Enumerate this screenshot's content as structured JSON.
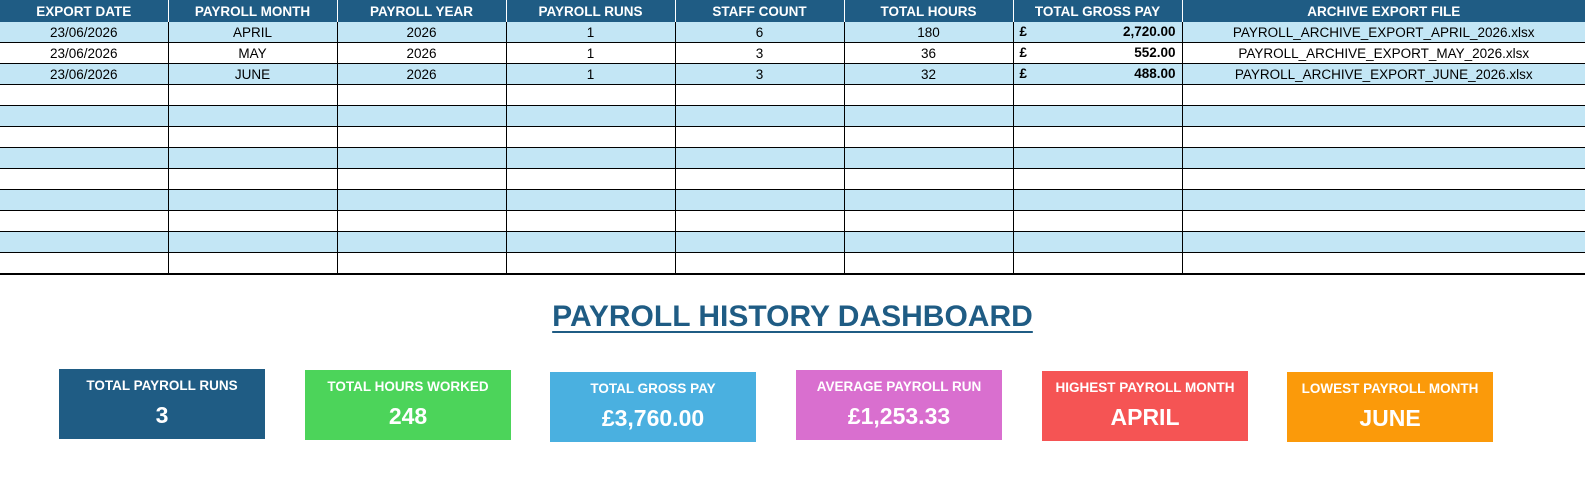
{
  "table": {
    "headers": [
      "EXPORT DATE",
      "PAYROLL MONTH",
      "PAYROLL YEAR",
      "PAYROLL RUNS",
      "STAFF COUNT",
      "TOTAL HOURS",
      "TOTAL GROSS PAY",
      "ARCHIVE EXPORT FILE"
    ],
    "currency_symbol": "£",
    "rows": [
      {
        "export_date": "23/06/2026",
        "month": "APRIL",
        "year": "2026",
        "runs": "1",
        "staff": "6",
        "hours": "180",
        "gross": "2,720.00",
        "file": "PAYROLL_ARCHIVE_EXPORT_APRIL_2026.xlsx"
      },
      {
        "export_date": "23/06/2026",
        "month": "MAY",
        "year": "2026",
        "runs": "1",
        "staff": "3",
        "hours": "36",
        "gross": "552.00",
        "file": "PAYROLL_ARCHIVE_EXPORT_MAY_2026.xlsx"
      },
      {
        "export_date": "23/06/2026",
        "month": "JUNE",
        "year": "2026",
        "runs": "1",
        "staff": "3",
        "hours": "32",
        "gross": "488.00",
        "file": "PAYROLL_ARCHIVE_EXPORT_JUNE_2026.xlsx"
      }
    ],
    "empty_row_count": 9
  },
  "dashboard": {
    "title": "PAYROLL HISTORY DASHBOARD",
    "cards": [
      {
        "label": "TOTAL PAYROLL RUNS",
        "value": "3",
        "color": "#1f5c84"
      },
      {
        "label": "TOTAL HOURS WORKED",
        "value": "248",
        "color": "#4cd45a"
      },
      {
        "label": "TOTAL GROSS PAY",
        "value": "£3,760.00",
        "color": "#4ab0e0"
      },
      {
        "label": "AVERAGE PAYROLL RUN",
        "value": "£1,253.33",
        "color": "#d96fcf"
      },
      {
        "label": "HIGHEST PAYROLL MONTH",
        "value": "APRIL",
        "color": "#f55454"
      },
      {
        "label": "LOWEST PAYROLL MONTH",
        "value": "JUNE",
        "color": "#fb9a0a"
      }
    ]
  }
}
